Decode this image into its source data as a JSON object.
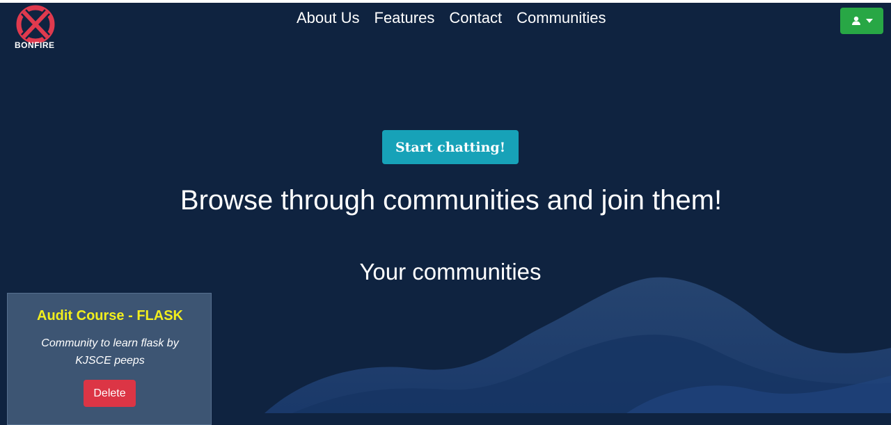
{
  "brand": {
    "name": "BONFIRE",
    "logo_icon": "crossed-circle-logo-icon",
    "logo_color": "#e03a4e"
  },
  "nav": {
    "items": [
      {
        "label": "About Us"
      },
      {
        "label": "Features"
      },
      {
        "label": "Contact"
      },
      {
        "label": "Communities"
      }
    ]
  },
  "user_menu": {
    "icon": "user-icon",
    "caret": "caret-down-icon",
    "color": "#28a745"
  },
  "hero": {
    "cta_label": "Start chatting!",
    "cta_color": "#17a2b8",
    "headline": "Browse through communities and join them!"
  },
  "communities": {
    "heading": "Your communities",
    "items": [
      {
        "title": "Audit Course - FLASK",
        "description": "Community to learn flask by KJSCE peeps",
        "delete_label": "Delete"
      }
    ]
  },
  "colors": {
    "background": "#0f2340",
    "card": "#3d5573",
    "title_yellow": "#f2ee1d",
    "danger": "#dc3545"
  }
}
